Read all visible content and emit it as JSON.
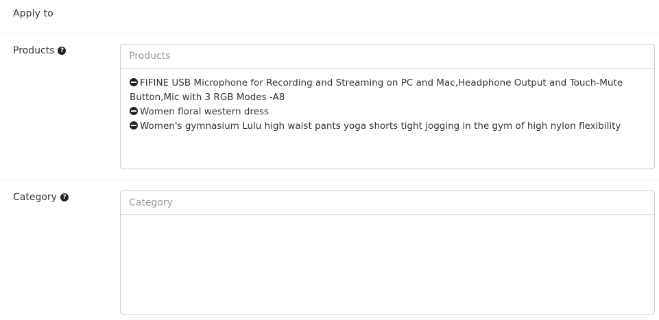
{
  "section": {
    "title": "Apply to"
  },
  "products": {
    "label": "Products",
    "help_icon": "question-circle-icon",
    "placeholder": "Products",
    "items": [
      "FIFINE USB Microphone for Recording and Streaming on PC and Mac,Headphone Output and Touch-Mute Button,Mic with 3 RGB Modes -A8",
      "Women floral western dress",
      "Women's gymnasium Lulu high waist pants yoga shorts tight jogging in the gym of high nylon flexibility"
    ],
    "remove_icon": "minus-circle-icon"
  },
  "category": {
    "label": "Category",
    "help_icon": "question-circle-icon",
    "placeholder": "Category",
    "items": []
  }
}
